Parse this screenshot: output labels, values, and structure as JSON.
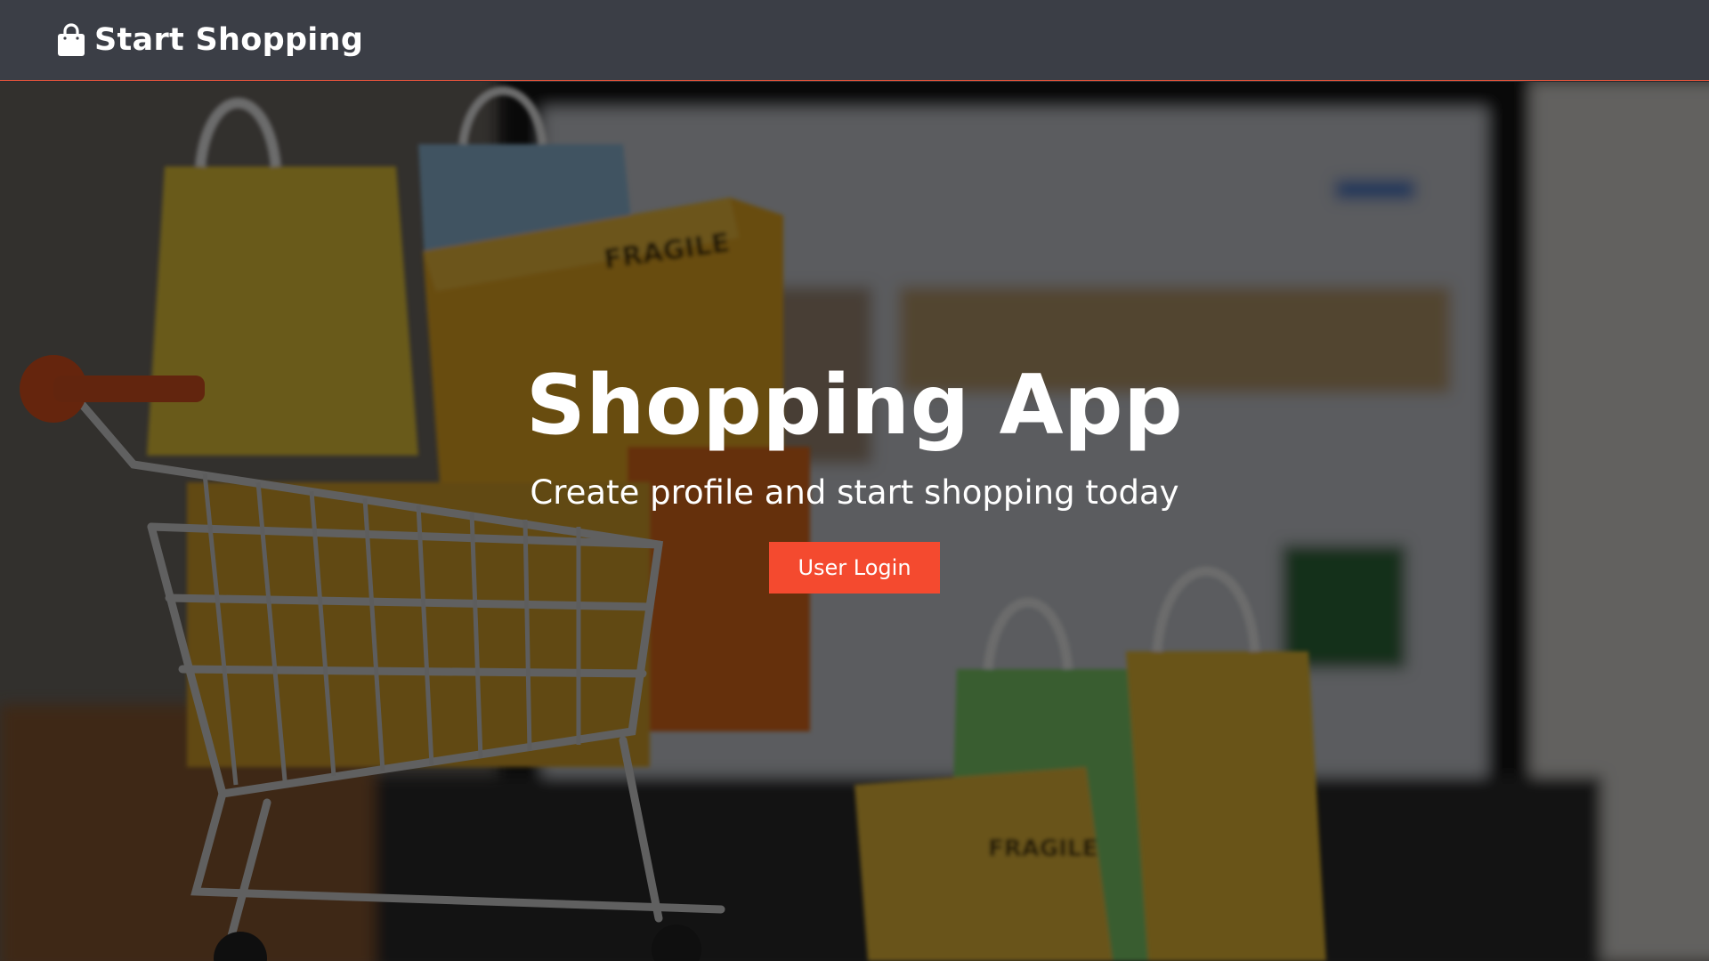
{
  "navbar": {
    "brand_icon": "shopping-bag-icon",
    "brand_label": "Start Shopping"
  },
  "hero": {
    "title": "Shopping App",
    "subtitle": "Create profile and start shopping today",
    "login_button_label": "User Login"
  },
  "colors": {
    "navbar_bg": "#3b3e46",
    "navbar_border": "#e0533a",
    "accent": "#f44a2f",
    "text": "#ffffff"
  }
}
